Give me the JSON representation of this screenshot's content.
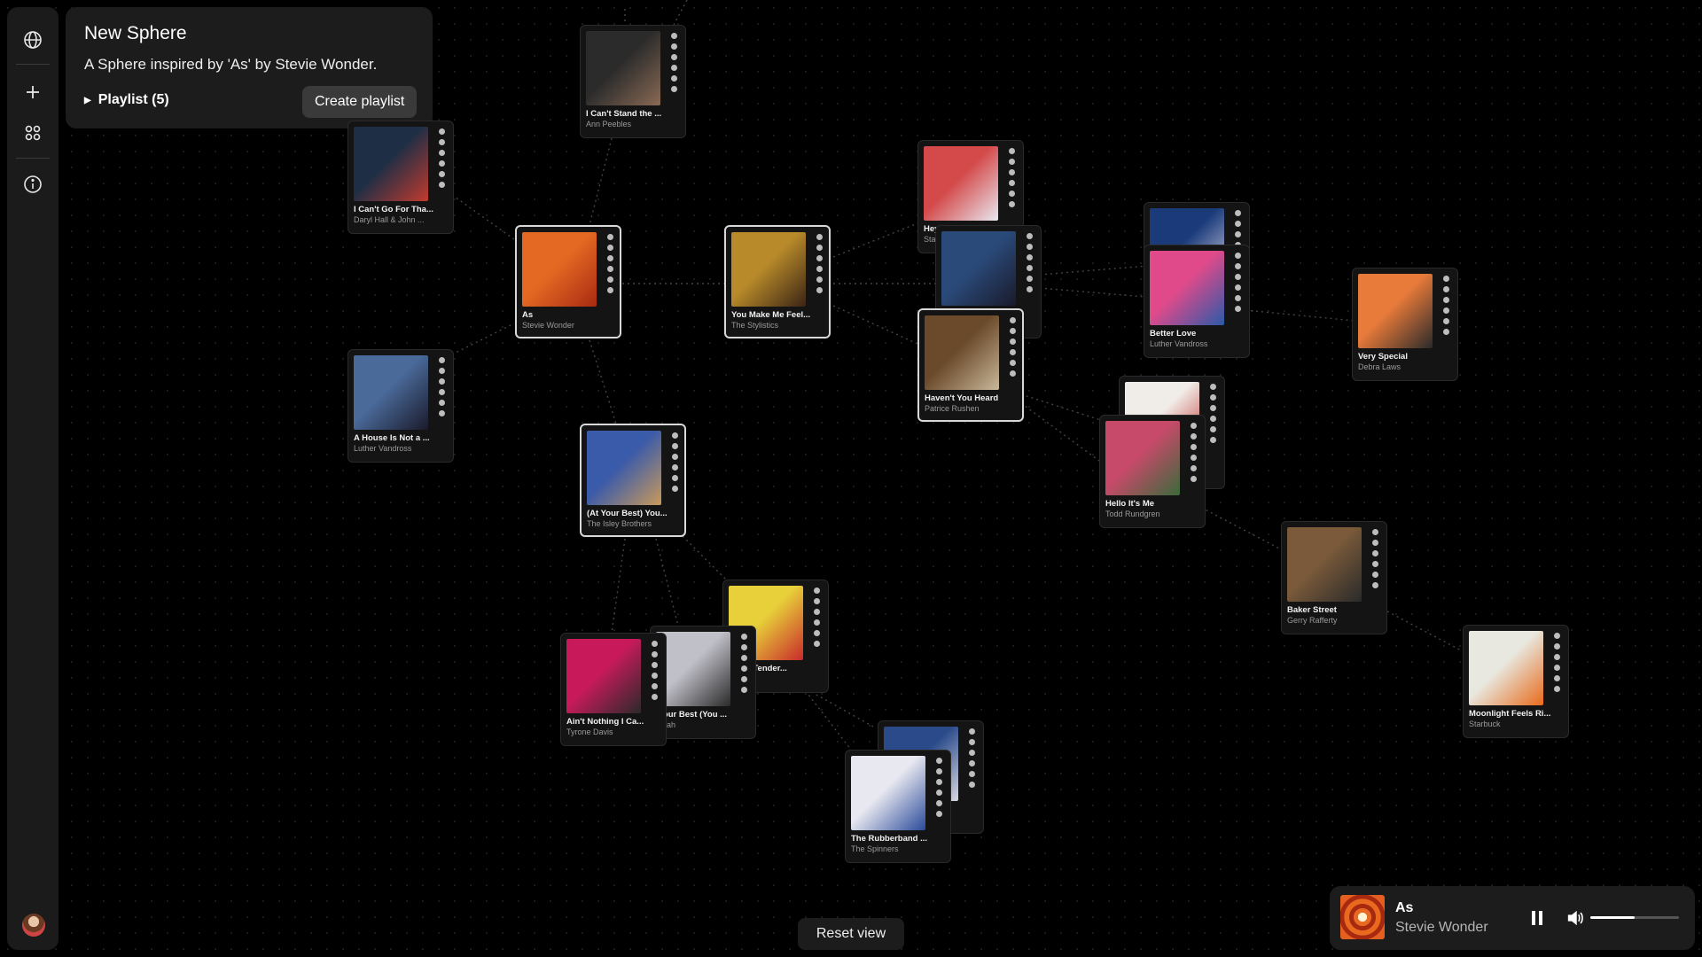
{
  "sidebar": {
    "items": [
      {
        "icon": "globe-icon"
      },
      {
        "icon": "plus-icon"
      },
      {
        "icon": "grid-icon"
      },
      {
        "icon": "info-icon"
      }
    ],
    "avatar": "user-avatar"
  },
  "panel": {
    "title": "New Sphere",
    "subtitle": "A Sphere inspired by 'As' by Stevie Wonder.",
    "playlist_label": "Playlist (5)",
    "create_label": "Create playlist"
  },
  "cards": [
    {
      "title": "I Can't Stand the ...",
      "artist": "Ann Peebles",
      "colors": [
        "#2b2b2b",
        "#8a6a55"
      ]
    },
    {
      "title": "I Can't Go For Tha...",
      "artist": "Daryl Hall & John ...",
      "colors": [
        "#1d2e45",
        "#c23b2f"
      ]
    },
    {
      "title": "As",
      "artist": "Stevie Wonder",
      "colors": [
        "#e46a23",
        "#a82a12"
      ]
    },
    {
      "title": "You Make Me Feel...",
      "artist": "The Stylistics",
      "colors": [
        "#b88a2a",
        "#3a2415"
      ]
    },
    {
      "title": "Hey ...",
      "artist": "Sta...",
      "colors": [
        "#d44a4a",
        "#e8e8f0"
      ]
    },
    {
      "title": "",
      "artist": "",
      "colors": [
        "#2a4a7a",
        "#1a1a2a"
      ]
    },
    {
      "title": "Haven't You Heard",
      "artist": "Patrice Rushen",
      "colors": [
        "#6a4a2a",
        "#c9b89a"
      ]
    },
    {
      "title": "",
      "artist": "",
      "colors": [
        "#1a3a7a",
        "#d0d0e0"
      ]
    },
    {
      "title": "Better Love",
      "artist": "Luther Vandross",
      "colors": [
        "#e04a8a",
        "#2a5aa8"
      ]
    },
    {
      "title": "Very Special",
      "artist": "Debra Laws",
      "colors": [
        "#e87a3a",
        "#2a2a2a"
      ]
    },
    {
      "title": "A House Is Not a ...",
      "artist": "Luther Vandross",
      "colors": [
        "#4a6a9a",
        "#1a1a2a"
      ]
    },
    {
      "title": "(At Your Best) You...",
      "artist": "The Isley Brothers",
      "colors": [
        "#3a5aaa",
        "#c89a5a"
      ]
    },
    {
      "title": "",
      "artist": "",
      "colors": [
        "#f0ece8",
        "#c0302a"
      ]
    },
    {
      "title": "Hello It's Me",
      "artist": "Todd Rundgren",
      "colors": [
        "#c84a6a",
        "#3a6a3a"
      ]
    },
    {
      "title": "Baker Street",
      "artist": "Gerry Rafferty",
      "colors": [
        "#7a5a3a",
        "#2a2a2a"
      ]
    },
    {
      "title": "...ittle Tender...",
      "artist": "...dding",
      "colors": [
        "#e8d03a",
        "#c82a2a"
      ]
    },
    {
      "title": "...our Best (You ...",
      "artist": "...yah",
      "colors": [
        "#c0c0c8",
        "#2a2a2a"
      ]
    },
    {
      "title": "Ain't Nothing I Ca...",
      "artist": "Tyrone Davis",
      "colors": [
        "#c81a5a",
        "#2a2a2a"
      ]
    },
    {
      "title": "",
      "artist": "",
      "colors": [
        "#2a4a8a",
        "#d8d8e0"
      ]
    },
    {
      "title": "The Rubberband ...",
      "artist": "The Spinners",
      "colors": [
        "#e8e8f0",
        "#2a4a9a"
      ]
    },
    {
      "title": "Moonlight Feels Ri...",
      "artist": "Starbuck",
      "colors": [
        "#e8e8e0",
        "#e86a1a"
      ]
    }
  ],
  "reset_label": "Reset view",
  "player": {
    "title": "As",
    "artist": "Stevie Wonder",
    "volume": 0.5,
    "state": "playing"
  }
}
